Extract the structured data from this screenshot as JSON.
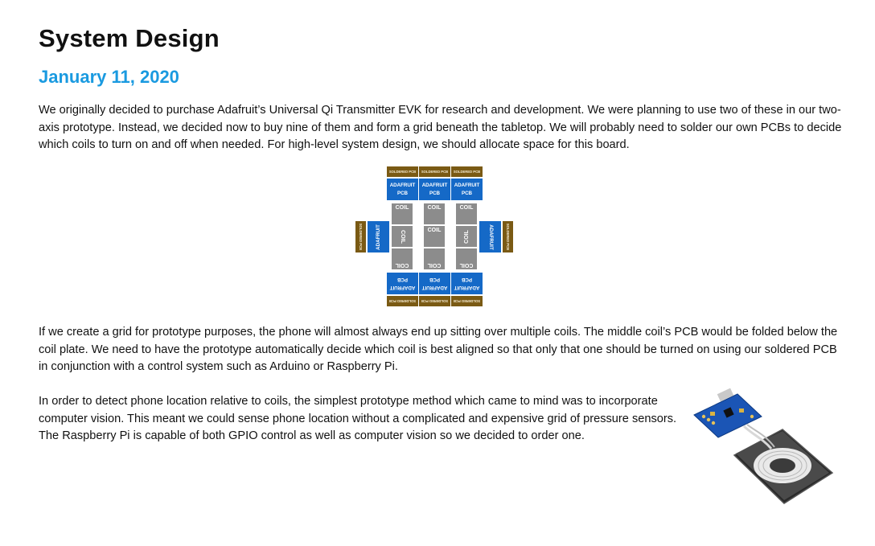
{
  "page": {
    "title": "System Design",
    "date": "January 11, 2020",
    "paragraphs": [
      "We originally decided to purchase Adafruit’s Universal Qi Transmitter EVK for research and development.  We were planning to use two of these in our two-axis prototype.  Instead, we decided now to buy nine of them and form a grid beneath the tabletop.  We will probably need to solder our own PCBs to decide which coils to turn on and off when needed.  For high-level system design, we should allocate space for this board.",
      "If we create a grid for prototype purposes, the phone will almost always end up sitting over multiple coils.  The middle coil’s PCB would be folded below the coil plate.  We need to have the prototype automatically decide which coil is best aligned so that only that one should be turned on using our soldered PCB in conjunction with a control system such as Arduino or Raspberry Pi.",
      "In order to detect phone location relative to coils, the simplest prototype method which came to mind was to incorporate computer vision.  This meant we could sense phone location without a complicated and expensive grid of pressure sensors.  The Raspberry Pi is capable of both GPIO control as well as computer vision so we decided to order one."
    ]
  },
  "diagram": {
    "soldered_label": "SOLDERED PCB",
    "adafruit_label": "ADAFRUIT",
    "pcb_label": "PCB",
    "coil_label": "COIL",
    "colors": {
      "soldered": "#7a5a14",
      "pcb": "#1569c7",
      "coil": "#8c8c8c"
    }
  },
  "colors": {
    "accent": "#1a9ae0",
    "text": "#111111"
  }
}
